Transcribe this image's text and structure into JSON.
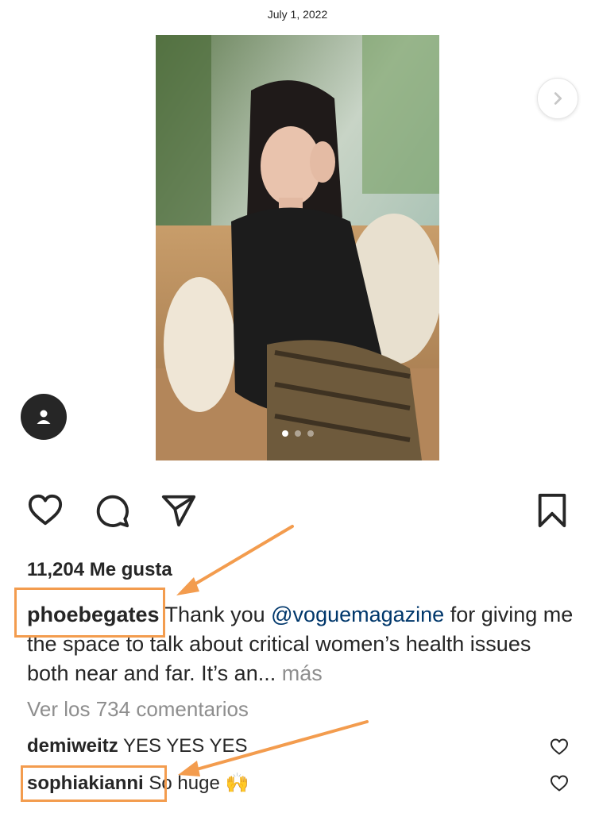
{
  "post": {
    "date": "July 1, 2022",
    "carousel": {
      "slide_count": 3,
      "active_index": 0
    }
  },
  "icons": {
    "like": "heart-icon",
    "comment": "comment-icon",
    "share": "paper-plane-icon",
    "save": "bookmark-icon",
    "next": "chevron-right-icon",
    "profile": "user-icon"
  },
  "likes": {
    "text": "11,204 Me gusta"
  },
  "caption": {
    "username": "phoebegates",
    "text_before": " Thank you ",
    "mention": "@voguemagazine",
    "text_after": " for giving me the space to talk about critical women’s health issues both near and far. It’s an... ",
    "more": "más"
  },
  "view_comments": "Ver los 734 comentarios",
  "comments": [
    {
      "username": "demiweitz",
      "text": " YES YES YES"
    },
    {
      "username": "sophiakianni",
      "text": " So huge 🙌"
    }
  ],
  "colors": {
    "highlight": "#f39c4e",
    "mention": "#00376b",
    "muted": "#8e8e8e",
    "text": "#262626"
  }
}
